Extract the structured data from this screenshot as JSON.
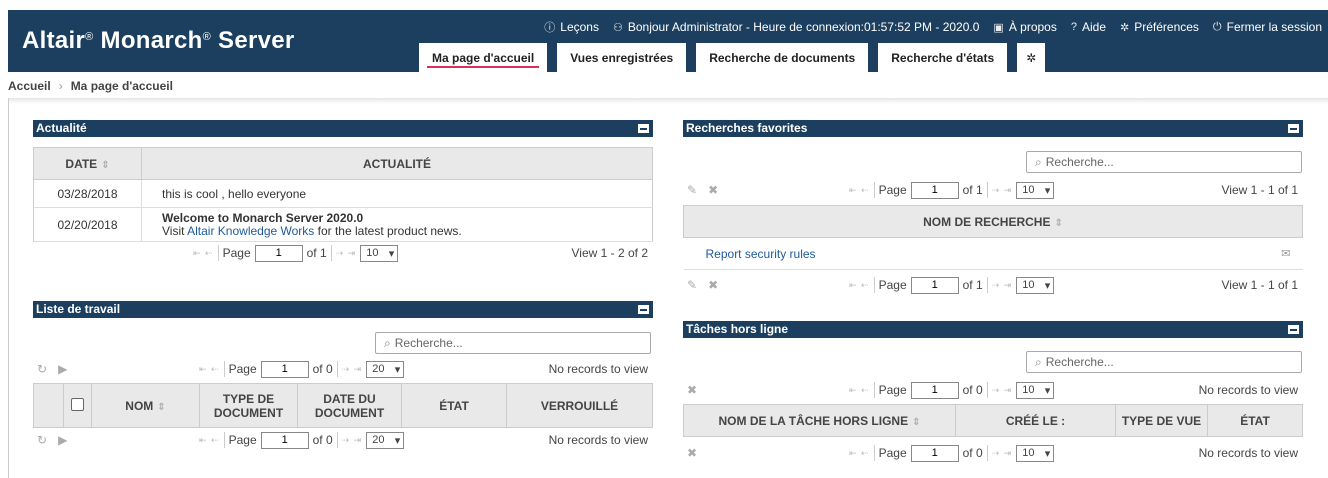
{
  "app": {
    "brand_name": "Altair",
    "brand_sup1": "®",
    "brand_mid": " Monarch",
    "brand_sup2": "®",
    "brand_tail": " Server"
  },
  "topnav": {
    "lessons": "Leçons",
    "user": "Bonjour Administrator - Heure de connexion:01:57:52 PM - 2020.0",
    "about": "À propos",
    "help": "Aide",
    "preferences": "Préférences",
    "logout": "Fermer la session"
  },
  "tabs": [
    "Ma page d'accueil",
    "Vues enregistrées",
    "Recherche de documents",
    "Recherche d'états"
  ],
  "breadcrumb": {
    "home": "Accueil",
    "separator": "›",
    "current": "Ma page d'accueil"
  },
  "news": {
    "title": "Actualité",
    "col_date": "DATE",
    "col_news": "ACTUALITÉ",
    "rows": [
      {
        "date": "03/28/2018",
        "text": "this is cool , hello everyone"
      },
      {
        "date": "02/20/2018",
        "headline": "Welcome to Monarch Server 2020.0",
        "pre": "Visit ",
        "link": "Altair Knowledge Works",
        "post": " for the latest product news."
      }
    ],
    "pager": {
      "page_label": "Page",
      "page": "1",
      "of": "of 1",
      "size": "10",
      "view": "View 1 - 2 of 2"
    }
  },
  "worklist": {
    "title": "Liste de travail",
    "search_placeholder": "Recherche...",
    "col_name": "NOM",
    "col_doctype": "TYPE DE DOCUMENT",
    "col_docdate": "DATE DU DOCUMENT",
    "col_state": "ÉTAT",
    "col_locked": "VERROUILLÉ",
    "pager": {
      "page_label": "Page",
      "page": "1",
      "of": "of 0",
      "size": "20",
      "view": "No records to view"
    }
  },
  "favorites": {
    "title": "Recherches favorites",
    "search_placeholder": "Recherche...",
    "col_name": "NOM DE RECHERCHE",
    "rows": [
      {
        "name": "Report security rules"
      }
    ],
    "pager": {
      "page_label": "Page",
      "page": "1",
      "of": "of 1",
      "size": "10",
      "view": "View 1 - 1 of 1"
    }
  },
  "offline": {
    "title": "Tâches hors ligne",
    "search_placeholder": "Recherche...",
    "col_task": "NOM DE LA TÂCHE HORS LIGNE",
    "col_created": "CRÉÉ LE :",
    "col_viewtype": "TYPE DE VUE",
    "col_state": "ÉTAT",
    "pager": {
      "page_label": "Page",
      "page": "1",
      "of": "of 0",
      "size": "10",
      "view": "No records to view"
    }
  },
  "colors": {
    "header": "#1c3f5f",
    "accent": "#d9325a",
    "link": "#1f5a9a"
  }
}
